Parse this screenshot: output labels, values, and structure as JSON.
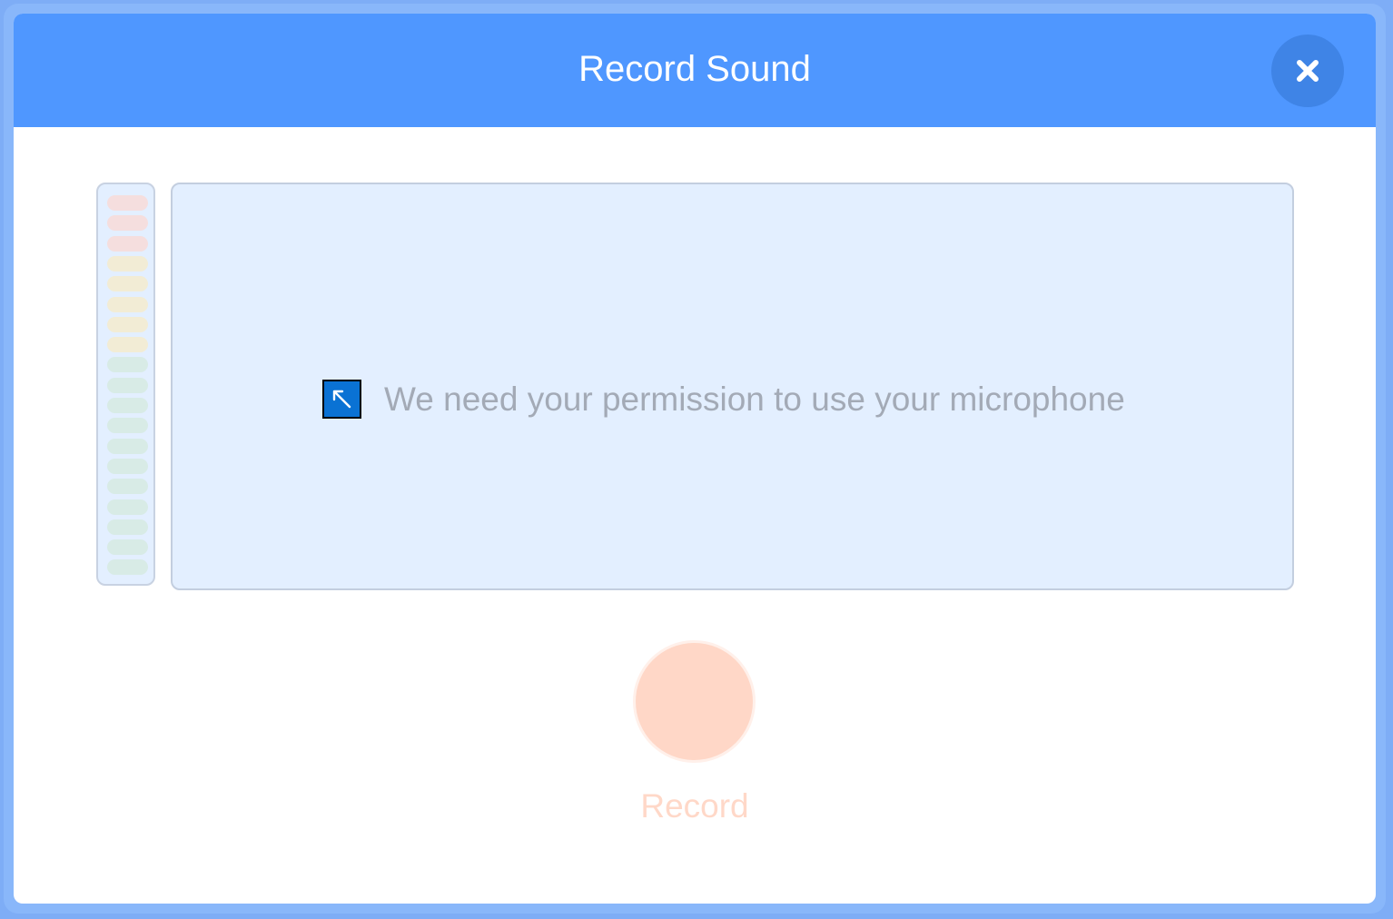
{
  "dialog": {
    "title": "Record Sound",
    "close_icon": "close-icon"
  },
  "meter": {
    "level": 0,
    "bar_colors": [
      "#f5dede",
      "#f5dede",
      "#f5dede",
      "#f2ecd5",
      "#f2ecd5",
      "#f2ecd5",
      "#f2ecd5",
      "#f2ecd5",
      "#d8ebe6",
      "#d8ebe6",
      "#d8ebe6",
      "#d8ebe6",
      "#d8ebe6",
      "#d8ebe6",
      "#d8ebe6",
      "#d8ebe6",
      "#d8ebe6",
      "#d8ebe6",
      "#d8ebe6"
    ]
  },
  "permission": {
    "icon": "arrow-up-left-icon",
    "message": "We need your permission to use your microphone"
  },
  "record": {
    "label": "Record",
    "button_color": "#ffd7c7"
  },
  "colors": {
    "header": "#4f97ff",
    "close_button": "#3f84e6",
    "panel_bg": "#e3efff"
  }
}
